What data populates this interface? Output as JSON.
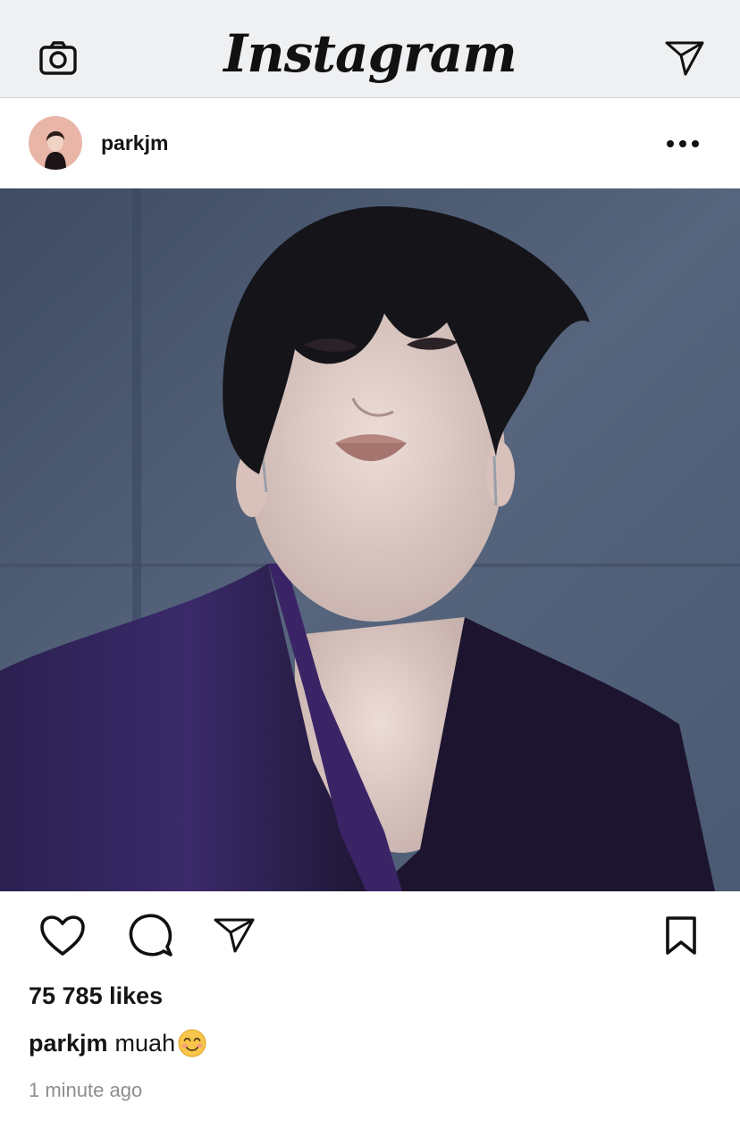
{
  "top_bar": {
    "title": "Instagram",
    "left_icon": "camera-icon",
    "right_icon": "paper-plane-icon"
  },
  "post": {
    "username": "parkjm",
    "avatar_icon": "profile-photo",
    "more_icon": "more-horizontal-icon",
    "image": "portrait photo of a dark-haired man in a purple velvet blazer against a blue-gray background",
    "actions": {
      "like_icon": "heart-icon",
      "comment_icon": "comment-icon",
      "share_icon": "paper-plane-icon",
      "save_icon": "bookmark-icon"
    },
    "likes": "75 785 likes",
    "caption": {
      "username": "parkjm",
      "text": "muah",
      "emoji_icon": "smiling-face-emoji"
    },
    "timestamp": "1 minute ago"
  },
  "colors": {
    "topbar_background": "#eff0f2",
    "text": "#151515",
    "secondary_text": "#8e8e8e",
    "image_background": "#4a5a72",
    "blazer": "#2e2352"
  }
}
